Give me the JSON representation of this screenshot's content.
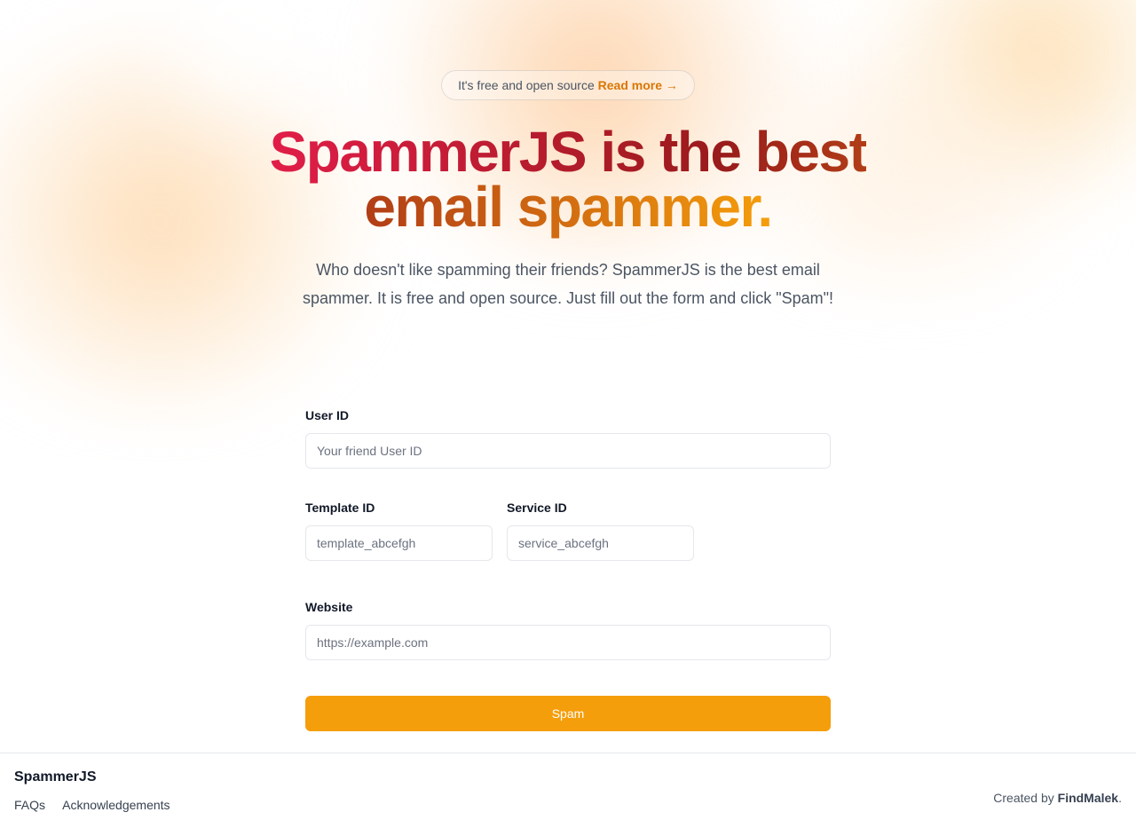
{
  "badge": {
    "text": "It's free and open source",
    "link_label": "Read more",
    "arrow": "→"
  },
  "headline": "SpammerJS is the best email spammer.",
  "subtitle": "Who doesn't like spamming their friends? SpammerJS is the best email spammer. It is free and open source. Just fill out the form and click \"Spam\"!",
  "form": {
    "user_id": {
      "label": "User ID",
      "placeholder": "Your friend User ID"
    },
    "template_id": {
      "label": "Template ID",
      "placeholder": "template_abcefgh"
    },
    "service_id": {
      "label": "Service ID",
      "placeholder": "service_abcefgh"
    },
    "website": {
      "label": "Website",
      "placeholder": "https://example.com"
    },
    "submit_label": "Spam"
  },
  "footer": {
    "brand": "SpammerJS",
    "links": [
      "FAQs",
      "Acknowledgements"
    ],
    "credit_prefix": "Created by",
    "credit_name": "FindMalek",
    "credit_suffix": "."
  },
  "colors": {
    "accent": "#f59e0b",
    "link": "#d97706",
    "gradient_start": "#e11d48",
    "gradient_mid": "#991b1b",
    "gradient_end": "#f59e0b"
  }
}
